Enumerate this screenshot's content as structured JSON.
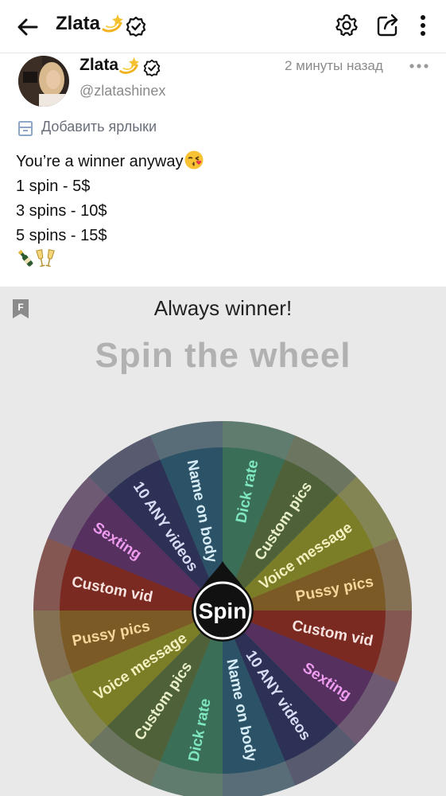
{
  "header": {
    "title": "Zlata",
    "title_emoji": "dizzy-star-emoji",
    "icons": [
      "back-arrow-icon",
      "verified-icon",
      "gear-icon",
      "share-icon",
      "more-vertical-icon"
    ]
  },
  "post": {
    "author_name": "Zlata",
    "handle": "@zlatashinex",
    "timestamp": "2 минуты назад",
    "add_labels": "Добавить ярлыки",
    "lines": [
      "You’re a winner anyway",
      "1 spin - 5$",
      "3 spins - 10$",
      "5 spins - 15$"
    ],
    "emojis": [
      "kissing-face-emoji",
      "champagne-emoji",
      "clinking-glasses-emoji"
    ]
  },
  "image": {
    "subtitle": "Always winner!",
    "headline": "Spin the wheel",
    "center_label": "Spin",
    "segments": [
      {
        "label": "Dick rate",
        "color": "#3a6e56",
        "text_color": "#7ee7c0"
      },
      {
        "label": "Custom pics",
        "color": "#4f6138",
        "text_color": "#e9f0c9"
      },
      {
        "label": "Voice message",
        "color": "#7b7d27",
        "text_color": "#f5f0bf"
      },
      {
        "label": "Pussy pics",
        "color": "#7c5a25",
        "text_color": "#f6d69a"
      },
      {
        "label": "Custom vid",
        "color": "#7b2a22",
        "text_color": "#f6e3df"
      },
      {
        "label": "Sexting",
        "color": "#56305f",
        "text_color": "#ef9cf0"
      },
      {
        "label": "10 ANY videos",
        "color": "#2c3155",
        "text_color": "#d9dcf4"
      },
      {
        "label": "Name on body",
        "color": "#2b5266",
        "text_color": "#d6ecf6"
      },
      {
        "label": "Dick rate",
        "color": "#3a6e56",
        "text_color": "#7ee7c0"
      },
      {
        "label": "Custom pics",
        "color": "#4f6138",
        "text_color": "#e9f0c9"
      },
      {
        "label": "Voice message",
        "color": "#7b7d27",
        "text_color": "#f5f0bf"
      },
      {
        "label": "Pussy pics",
        "color": "#7c5a25",
        "text_color": "#f6d69a"
      },
      {
        "label": "Custom vid",
        "color": "#7b2a22",
        "text_color": "#f6e3df"
      },
      {
        "label": "Sexting",
        "color": "#56305f",
        "text_color": "#ef9cf0"
      },
      {
        "label": "10 ANY videos",
        "color": "#2c3155",
        "text_color": "#d9dcf4"
      },
      {
        "label": "Name on body",
        "color": "#2b5266",
        "text_color": "#d6ecf6"
      }
    ]
  }
}
